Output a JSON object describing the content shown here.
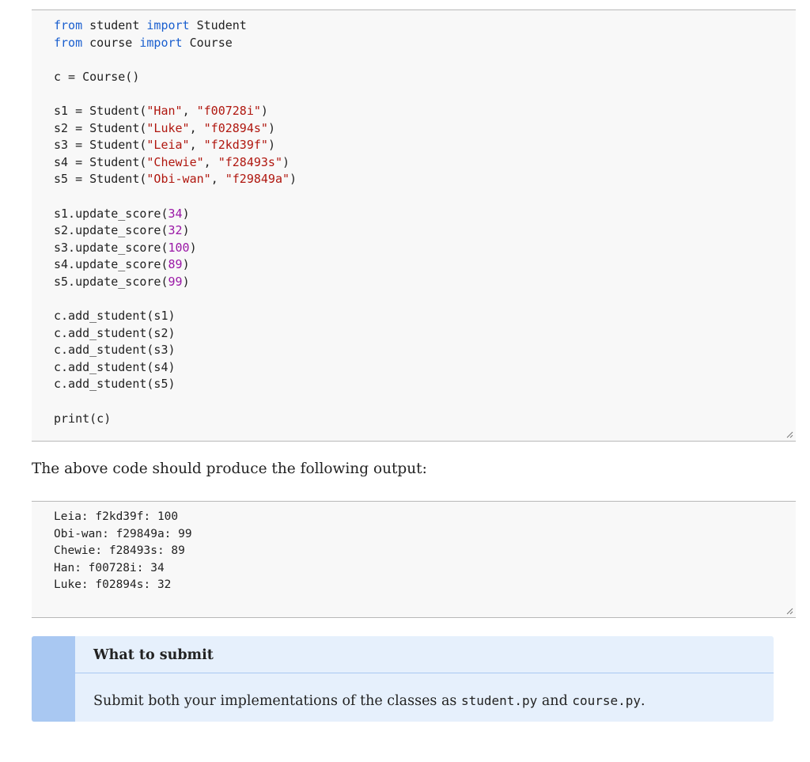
{
  "code_example": {
    "lines": [
      [
        {
          "t": "kw",
          "v": "from"
        },
        {
          "t": "plain",
          "v": " student "
        },
        {
          "t": "kw",
          "v": "import"
        },
        {
          "t": "plain",
          "v": " Student"
        }
      ],
      [
        {
          "t": "kw",
          "v": "from"
        },
        {
          "t": "plain",
          "v": " course "
        },
        {
          "t": "kw",
          "v": "import"
        },
        {
          "t": "plain",
          "v": " Course"
        }
      ],
      [],
      [
        {
          "t": "plain",
          "v": "c = Course()"
        }
      ],
      [],
      [
        {
          "t": "plain",
          "v": "s1 = Student("
        },
        {
          "t": "str",
          "v": "\"Han\""
        },
        {
          "t": "plain",
          "v": ", "
        },
        {
          "t": "str",
          "v": "\"f00728i\""
        },
        {
          "t": "plain",
          "v": ")"
        }
      ],
      [
        {
          "t": "plain",
          "v": "s2 = Student("
        },
        {
          "t": "str",
          "v": "\"Luke\""
        },
        {
          "t": "plain",
          "v": ", "
        },
        {
          "t": "str",
          "v": "\"f02894s\""
        },
        {
          "t": "plain",
          "v": ")"
        }
      ],
      [
        {
          "t": "plain",
          "v": "s3 = Student("
        },
        {
          "t": "str",
          "v": "\"Leia\""
        },
        {
          "t": "plain",
          "v": ", "
        },
        {
          "t": "str",
          "v": "\"f2kd39f\""
        },
        {
          "t": "plain",
          "v": ")"
        }
      ],
      [
        {
          "t": "plain",
          "v": "s4 = Student("
        },
        {
          "t": "str",
          "v": "\"Chewie\""
        },
        {
          "t": "plain",
          "v": ", "
        },
        {
          "t": "str",
          "v": "\"f28493s\""
        },
        {
          "t": "plain",
          "v": ")"
        }
      ],
      [
        {
          "t": "plain",
          "v": "s5 = Student("
        },
        {
          "t": "str",
          "v": "\"Obi-wan\""
        },
        {
          "t": "plain",
          "v": ", "
        },
        {
          "t": "str",
          "v": "\"f29849a\""
        },
        {
          "t": "plain",
          "v": ")"
        }
      ],
      [],
      [
        {
          "t": "plain",
          "v": "s1.update_score("
        },
        {
          "t": "num",
          "v": "34"
        },
        {
          "t": "plain",
          "v": ")"
        }
      ],
      [
        {
          "t": "plain",
          "v": "s2.update_score("
        },
        {
          "t": "num",
          "v": "32"
        },
        {
          "t": "plain",
          "v": ")"
        }
      ],
      [
        {
          "t": "plain",
          "v": "s3.update_score("
        },
        {
          "t": "num",
          "v": "100"
        },
        {
          "t": "plain",
          "v": ")"
        }
      ],
      [
        {
          "t": "plain",
          "v": "s4.update_score("
        },
        {
          "t": "num",
          "v": "89"
        },
        {
          "t": "plain",
          "v": ")"
        }
      ],
      [
        {
          "t": "plain",
          "v": "s5.update_score("
        },
        {
          "t": "num",
          "v": "99"
        },
        {
          "t": "plain",
          "v": ")"
        }
      ],
      [],
      [
        {
          "t": "plain",
          "v": "c.add_student(s1)"
        }
      ],
      [
        {
          "t": "plain",
          "v": "c.add_student(s2)"
        }
      ],
      [
        {
          "t": "plain",
          "v": "c.add_student(s3)"
        }
      ],
      [
        {
          "t": "plain",
          "v": "c.add_student(s4)"
        }
      ],
      [
        {
          "t": "plain",
          "v": "c.add_student(s5)"
        }
      ],
      [],
      [
        {
          "t": "plain",
          "v": "print(c)"
        }
      ]
    ]
  },
  "intro_text": "The above code should produce the following output:",
  "output_example": {
    "lines": [
      "Leia: f2kd39f: 100",
      "Obi-wan: f29849a: 99",
      "Chewie: f28493s: 89",
      "Han: f00728i: 34",
      "Luke: f02894s: 32"
    ]
  },
  "submit_box": {
    "title": "What to submit",
    "body_prefix": "Submit both your implementations of the classes as ",
    "file_1": "student.py",
    "body_and": " and ",
    "file_2": "course.py",
    "body_suffix": "."
  },
  "colors": {
    "keyword": "#1a5fcf",
    "string": "#b0170f",
    "number": "#9a17a6",
    "callout_background": "#e6f0fc",
    "callout_accent": "#a9c8f2"
  },
  "icons": {
    "resize_grip": "resize-grip-icon"
  }
}
